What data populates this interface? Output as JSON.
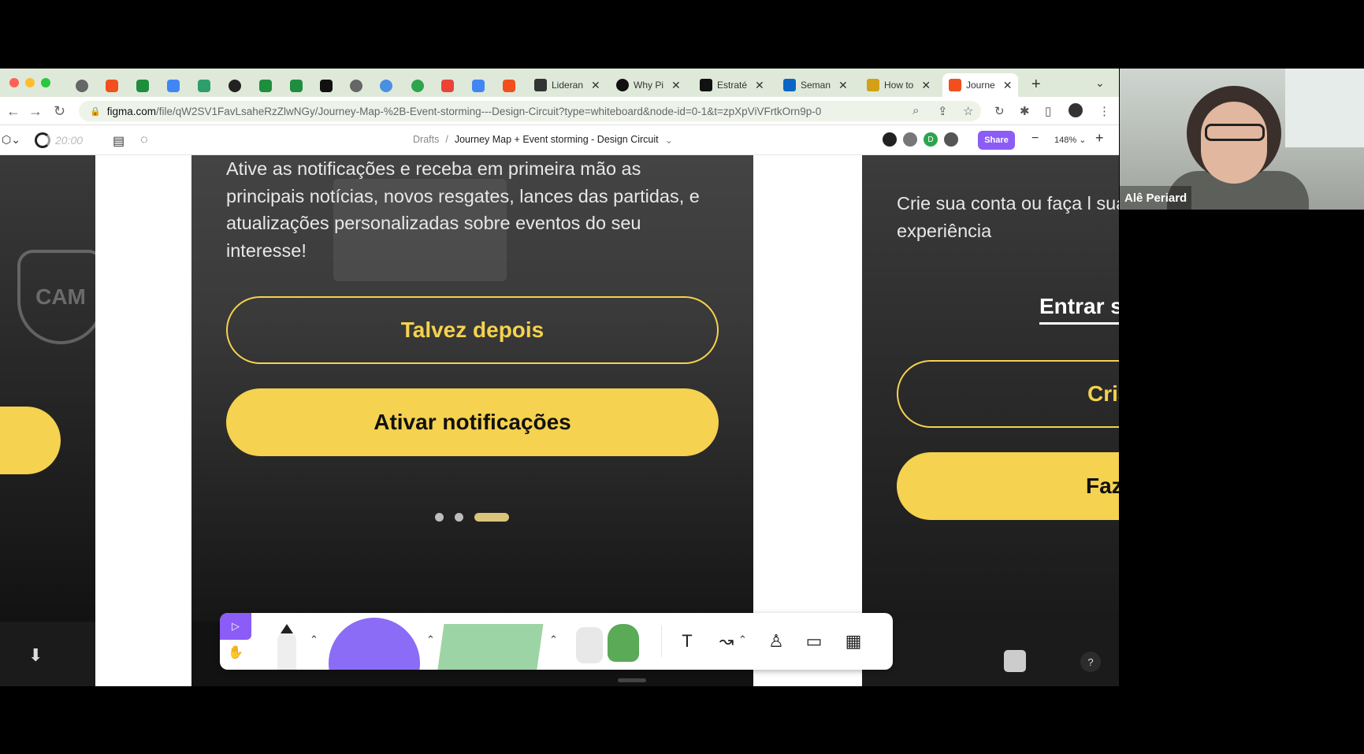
{
  "browser": {
    "tabs": [
      {
        "label": "Lideran",
        "color": "#333"
      },
      {
        "label": "Why Pi",
        "color": "#111"
      },
      {
        "label": "Estraté",
        "color": "#111"
      },
      {
        "label": "Seman",
        "color": "#0a66c2"
      },
      {
        "label": "How to",
        "color": "#d4a017"
      },
      {
        "label": "Journe",
        "color": "#f24e1e"
      }
    ],
    "url_host": "figma.com",
    "url_path": "/file/qW2SV1FavLsaheRzZlwNGy/Journey-Map-%2B-Event-storming---Design-Circuit?type=whiteboard&node-id=0-1&t=zpXpViVFrtkOrn9p-0"
  },
  "figma": {
    "timer": "20:00",
    "breadcrumb_drafts": "Drafts",
    "breadcrumb_separator": "/",
    "file_name": "Journey Map + Event storming - Design Circuit",
    "share_label": "Share",
    "zoom": "148%",
    "avatar_initial": "D"
  },
  "canvas": {
    "main_frame": {
      "body_text": "Ative as notificações e receba em primeira mão as principais notícias, novos resgates, lances das partidas, e atualizações personalizadas sobre eventos do seu interesse!",
      "secondary_button": "Talvez depois",
      "primary_button": "Ativar notificações"
    },
    "right_frame": {
      "subtitle": "Crie sua conta ou faça l sua experiência",
      "link_text": "Entrar s",
      "outline_button": "Cria",
      "solid_button": "Faz"
    }
  },
  "help_label": "?",
  "webcam": {
    "participant_name": "Alê Periard"
  },
  "colors": {
    "accent_yellow": "#f5d24f",
    "figma_purple": "#8b5cf6"
  }
}
